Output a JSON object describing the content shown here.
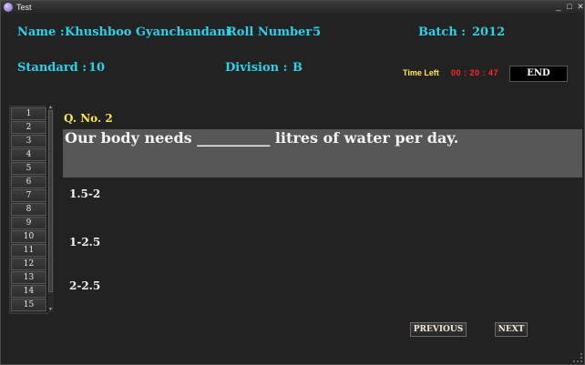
{
  "window": {
    "title": "Test",
    "min": "_",
    "max": "□",
    "close": "✕"
  },
  "student": {
    "name_label": "Name :",
    "name": "Khushboo Gyanchandani",
    "roll_label": "Roll Number :",
    "roll": "5",
    "batch_label": "Batch :",
    "batch": "2012",
    "standard_label": "Standard :",
    "standard": "10",
    "division_label": "Division :",
    "division": "B"
  },
  "timer": {
    "label": "Time Left",
    "value": "00 : 20 : 47"
  },
  "end_button": "END",
  "question_numbers": [
    "1",
    "2",
    "3",
    "4",
    "5",
    "6",
    "7",
    "8",
    "9",
    "10",
    "11",
    "12",
    "13",
    "14",
    "15"
  ],
  "question": {
    "number_label": "Q. No. 2",
    "text": "Our body needs __________ litres of water per day.",
    "options": [
      "1.5-2",
      "1-2.5",
      "2-2.5"
    ]
  },
  "nav": {
    "previous": "PREVIOUS",
    "next": "NEXT"
  },
  "colors": {
    "info": "#27d3e8",
    "timer_label": "#ffe94a",
    "timer_value": "#ff2a2a",
    "background": "#222222",
    "question_panel": "#575757"
  }
}
